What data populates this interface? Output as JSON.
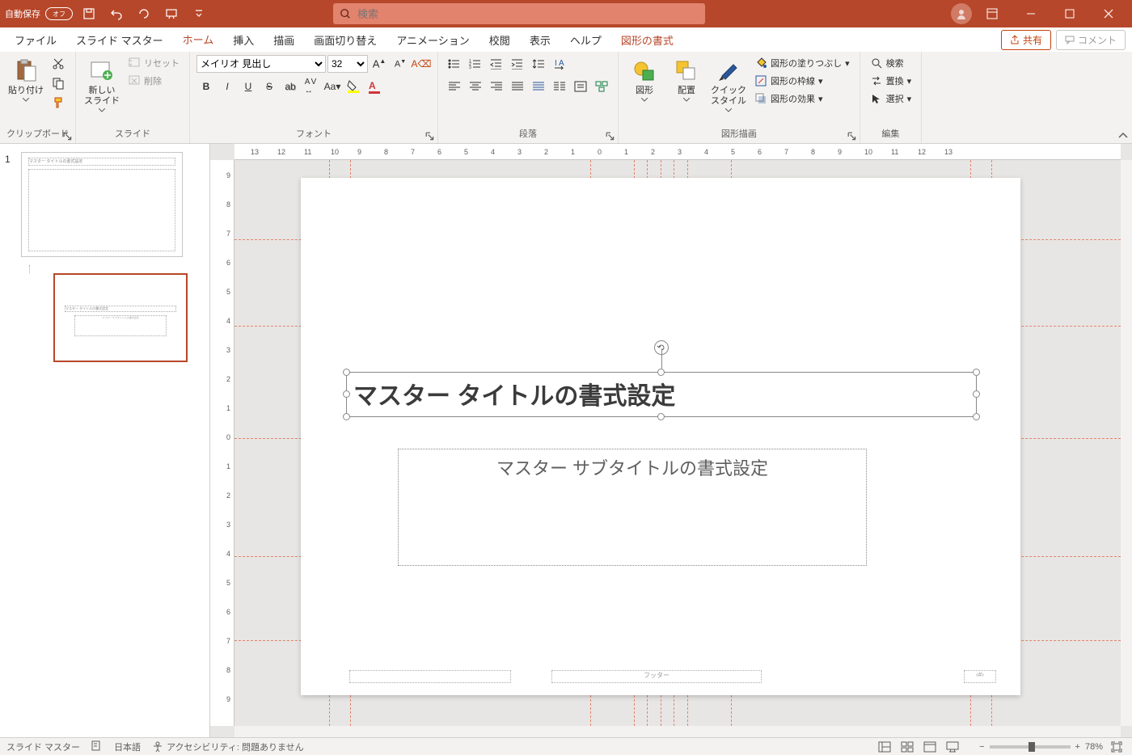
{
  "titlebar": {
    "autosave_label": "自動保存",
    "autosave_state": "オフ",
    "search_placeholder": "検索"
  },
  "tabs": {
    "file": "ファイル",
    "slide_master": "スライド マスター",
    "home": "ホーム",
    "insert": "挿入",
    "draw": "描画",
    "transitions": "画面切り替え",
    "animations": "アニメーション",
    "review": "校閲",
    "view": "表示",
    "help": "ヘルプ",
    "shape_format": "図形の書式",
    "share": "共有",
    "comments": "コメント"
  },
  "ribbon": {
    "clipboard": {
      "paste": "貼り付け",
      "label": "クリップボード"
    },
    "slides": {
      "new_slide": "新しい\nスライド",
      "reset": "リセット",
      "delete": "削除",
      "label": "スライド"
    },
    "font": {
      "name": "メイリオ 見出し",
      "size": "32",
      "label": "フォント"
    },
    "paragraph": {
      "label": "段落"
    },
    "drawing": {
      "shapes": "図形",
      "arrange": "配置",
      "quickstyles": "クイック\nスタイル",
      "fill": "図形の塗りつぶし",
      "outline": "図形の枠線",
      "effects": "図形の効果",
      "label": "図形描画"
    },
    "editing": {
      "find": "検索",
      "replace": "置換",
      "select": "選択",
      "label": "編集"
    }
  },
  "thumbs": {
    "num1": "1"
  },
  "slide": {
    "title": "マスター タイトルの書式設定",
    "subtitle": "マスター サブタイトルの書式設定",
    "footer": "フッター",
    "pagenum": "‹#›"
  },
  "ruler_h": [
    "13",
    "12",
    "11",
    "10",
    "9",
    "8",
    "7",
    "6",
    "5",
    "4",
    "3",
    "2",
    "1",
    "0",
    "1",
    "2",
    "3",
    "4",
    "5",
    "6",
    "7",
    "8",
    "9",
    "10",
    "11",
    "12",
    "13"
  ],
  "ruler_v": [
    "9",
    "8",
    "7",
    "6",
    "5",
    "4",
    "3",
    "2",
    "1",
    "0",
    "1",
    "2",
    "3",
    "4",
    "5",
    "6",
    "7",
    "8",
    "9"
  ],
  "statusbar": {
    "mode": "スライド マスター",
    "language": "日本語",
    "accessibility": "アクセシビリティ: 問題ありません",
    "zoom": "78%"
  }
}
